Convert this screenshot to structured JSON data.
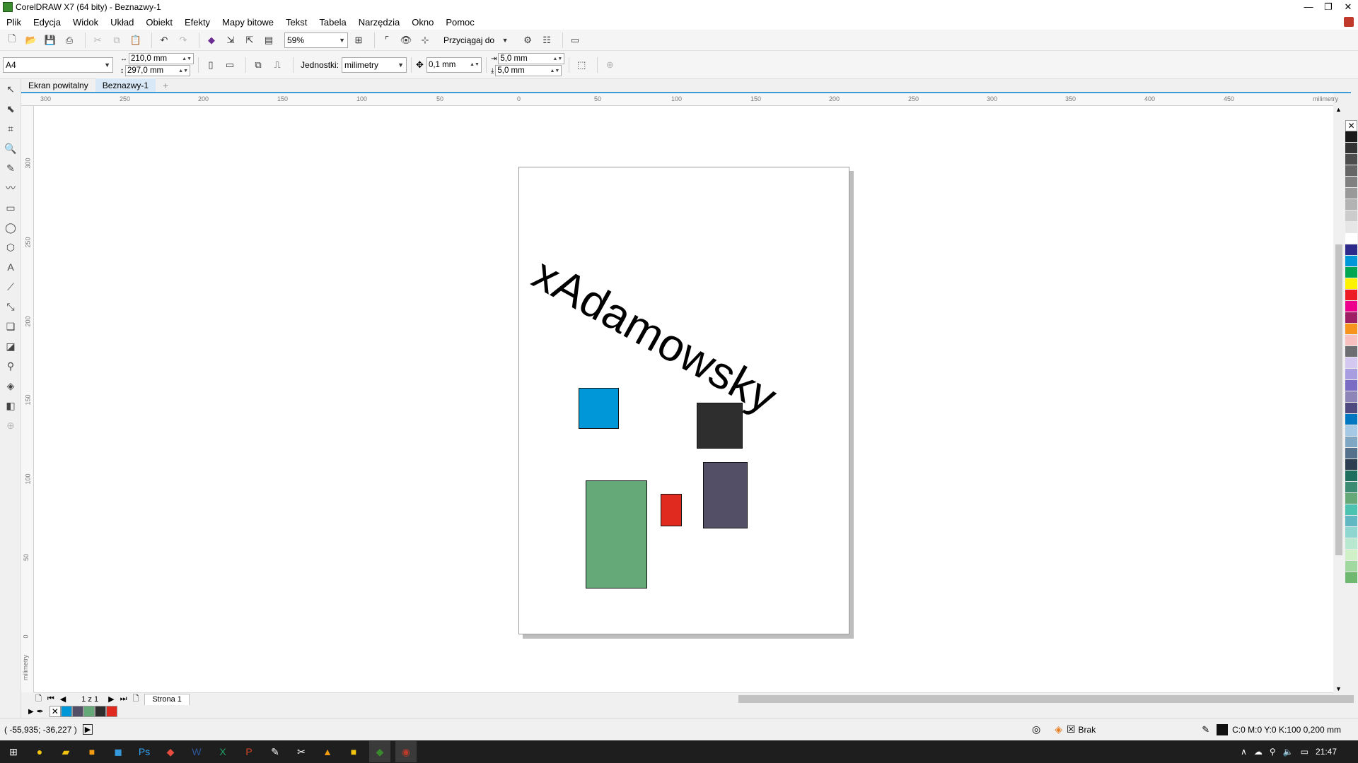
{
  "window": {
    "title": "CorelDRAW X7 (64 bity) - Beznazwy-1",
    "minimize": "—",
    "restore": "❐",
    "close": "✕"
  },
  "menu": [
    {
      "label": "Plik"
    },
    {
      "label": "Edycja"
    },
    {
      "label": "Widok"
    },
    {
      "label": "Układ"
    },
    {
      "label": "Obiekt"
    },
    {
      "label": "Efekty"
    },
    {
      "label": "Mapy bitowe"
    },
    {
      "label": "Tekst"
    },
    {
      "label": "Tabela"
    },
    {
      "label": "Narzędzia"
    },
    {
      "label": "Okno"
    },
    {
      "label": "Pomoc"
    }
  ],
  "toolbar": {
    "zoom": "59%",
    "snap_label": "Przyciągaj do"
  },
  "propbar": {
    "page_size": "A4",
    "width": "210,0 mm",
    "height": "297,0 mm",
    "units_label": "Jednostki:",
    "units_value": "milimetry",
    "nudge": "0,1 mm",
    "dup_x": "5,0 mm",
    "dup_y": "5,0 mm"
  },
  "tabs": {
    "welcome": "Ekran powitalny",
    "doc": "Beznazwy-1",
    "add": "+"
  },
  "ruler": {
    "unit": "milimetry",
    "h_ticks": [
      "300",
      "250",
      "200",
      "150",
      "100",
      "50",
      "0",
      "50",
      "100",
      "150",
      "200",
      "250",
      "300",
      "350",
      "400",
      "450"
    ],
    "v_ticks": [
      "300",
      "250",
      "200",
      "150",
      "100",
      "50",
      "0"
    ]
  },
  "canvas": {
    "watermark": "xAdamowsky"
  },
  "shapes": [
    {
      "name": "blue-rectangle",
      "color": "#0097d8"
    },
    {
      "name": "black-rectangle",
      "color": "#2e2e2e"
    },
    {
      "name": "green-rectangle",
      "color": "#66a978"
    },
    {
      "name": "red-rectangle",
      "color": "#e02a20"
    },
    {
      "name": "slate-rectangle",
      "color": "#534f66"
    }
  ],
  "pagenav": {
    "counter": "1 z 1",
    "page_tab": "Strona 1"
  },
  "doc_palette": [
    "#0097d8",
    "#534f66",
    "#66a978",
    "#2e2e2e",
    "#e02a20"
  ],
  "palette": [
    "#1a1a1a",
    "#333333",
    "#4d4d4d",
    "#666666",
    "#808080",
    "#999999",
    "#b3b3b3",
    "#cccccc",
    "#e6e6e6",
    "#ffffff",
    "#2d2a8c",
    "#0097d8",
    "#00a651",
    "#fff200",
    "#ed1c24",
    "#ec008c",
    "#9e1f63",
    "#f7941d",
    "#f9c0c0",
    "#6d6e71",
    "#d4c7f0",
    "#a89de0",
    "#7a6cc4",
    "#8d85b8",
    "#4f4a80",
    "#0077c0",
    "#a5c8e4",
    "#7fa7c4",
    "#56718b",
    "#2c3e50",
    "#1f6f5f",
    "#3c8c74",
    "#66a978",
    "#4cc3b0",
    "#5fb8c2",
    "#8ed6d0",
    "#b8e8d0",
    "#d0f0c8",
    "#a0d8a0",
    "#6fb86f"
  ],
  "status": {
    "coords": "( -55,935; -36,227 )",
    "fill_label": "Brak",
    "outline": "C:0 M:0 Y:0 K:100  0,200 mm"
  },
  "taskbar": {
    "time": "21:47"
  }
}
